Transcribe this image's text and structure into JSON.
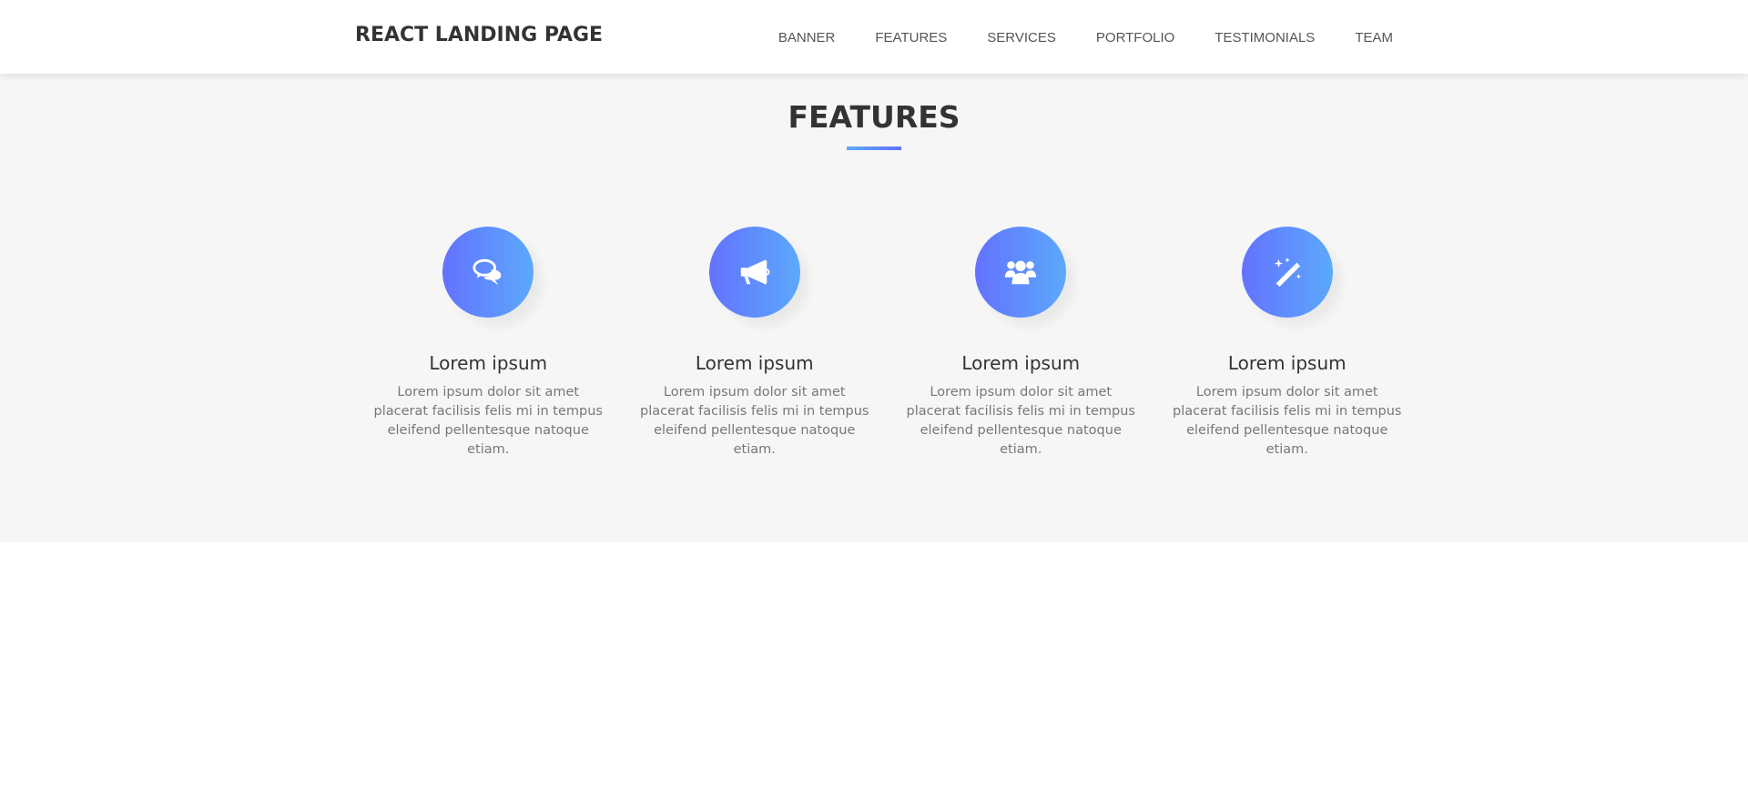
{
  "nav": {
    "brand": "REACT LANDING PAGE",
    "links": [
      "BANNER",
      "FEATURES",
      "SERVICES",
      "PORTFOLIO",
      "TESTIMONIALS",
      "TEAM"
    ]
  },
  "features": {
    "title": "FEATURES",
    "items": [
      {
        "icon": "comments-icon",
        "title": "Lorem ipsum",
        "text": "Lorem ipsum dolor sit amet placerat facilisis felis mi in tempus eleifend pellentesque natoque etiam."
      },
      {
        "icon": "bullhorn-icon",
        "title": "Lorem ipsum",
        "text": "Lorem ipsum dolor sit amet placerat facilisis felis mi in tempus eleifend pellentesque natoque etiam."
      },
      {
        "icon": "group-icon",
        "title": "Lorem ipsum",
        "text": "Lorem ipsum dolor sit amet placerat facilisis felis mi in tempus eleifend pellentesque natoque etiam."
      },
      {
        "icon": "magic-icon",
        "title": "Lorem ipsum",
        "text": "Lorem ipsum dolor sit amet placerat facilisis felis mi in tempus eleifend pellentesque natoque etiam."
      }
    ]
  },
  "colors": {
    "gradient_start": "#6372ff",
    "gradient_end": "#5ca9fb",
    "section_bg": "#f6f6f6"
  }
}
